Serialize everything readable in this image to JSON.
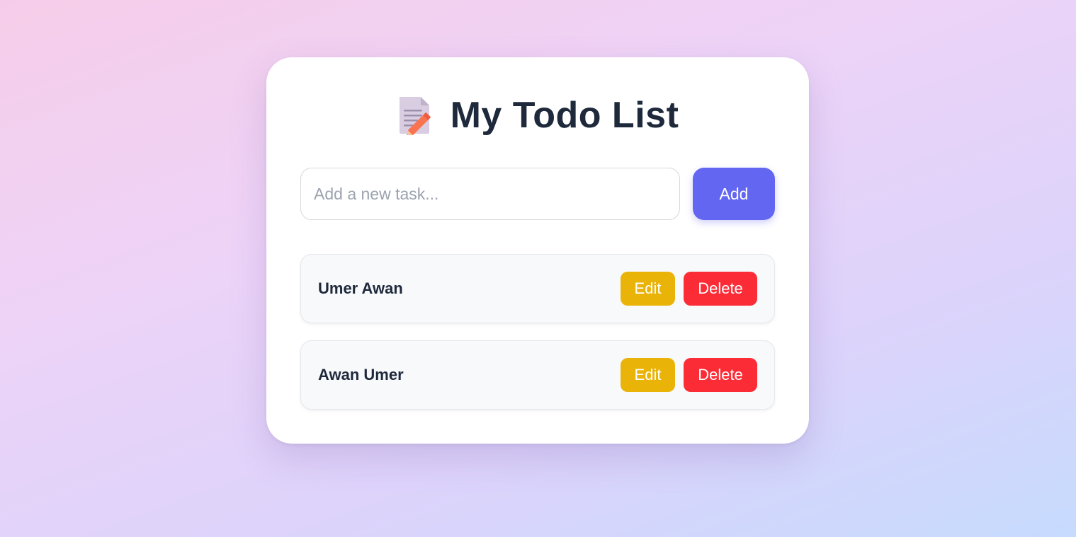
{
  "header": {
    "icon": "memo-icon",
    "title": "My Todo List"
  },
  "add_form": {
    "input_value": "",
    "placeholder": "Add a new task...",
    "add_label": "Add"
  },
  "todos": [
    {
      "text": "Umer Awan",
      "edit_label": "Edit",
      "delete_label": "Delete"
    },
    {
      "text": "Awan Umer",
      "edit_label": "Edit",
      "delete_label": "Delete"
    }
  ],
  "colors": {
    "accent": "#6366f1",
    "edit": "#eab308",
    "delete": "#fb2c36",
    "text": "#1e293b"
  }
}
